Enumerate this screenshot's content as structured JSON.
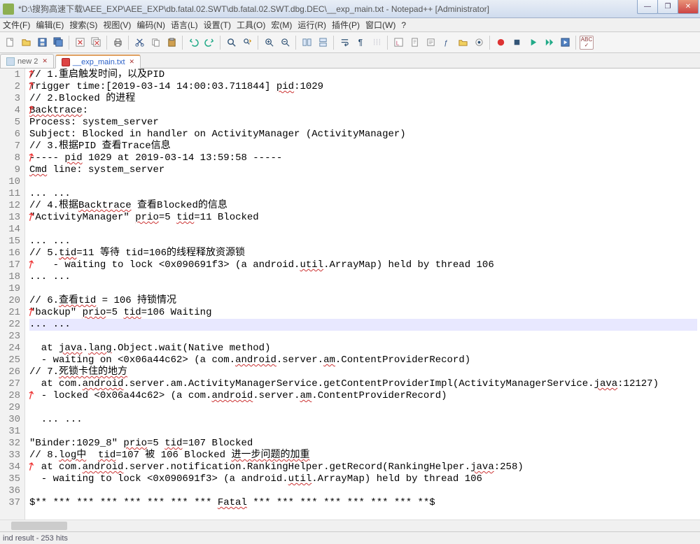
{
  "title": "*D:\\搜狗高速下载\\AEE_EXP\\AEE_EXP\\db.fatal.02.SWT\\db.fatal.02.SWT.dbg.DEC\\__exp_main.txt - Notepad++ [Administrator]",
  "win_controls": {
    "min": "—",
    "max": "❐",
    "close": "✕"
  },
  "menu": [
    "文件(F)",
    "编辑(E)",
    "搜索(S)",
    "视图(V)",
    "编码(N)",
    "语言(L)",
    "设置(T)",
    "工具(O)",
    "宏(M)",
    "运行(R)",
    "插件(P)",
    "窗口(W)",
    "?"
  ],
  "tabs": [
    {
      "label": "new 2",
      "active": false,
      "icon": "#6c8"
    },
    {
      "label": "__exp_main.txt",
      "active": true,
      "icon": "#d44"
    }
  ],
  "code_lines": [
    {
      "n": 1,
      "arrow": true,
      "text": "// 1.重启触发时间，以及PID"
    },
    {
      "n": 2,
      "arrow": true,
      "text": "Trigger time:[2019-03-14 14:00:03.711844] pid:1029",
      "wavy": [
        "pid"
      ]
    },
    {
      "n": 3,
      "arrow": false,
      "text": "// 2.Blocked 的进程"
    },
    {
      "n": 4,
      "arrow": true,
      "text": "Backtrace:",
      "wavy": [
        "Backtrace"
      ]
    },
    {
      "n": 5,
      "arrow": false,
      "text": "Process: system_server"
    },
    {
      "n": 6,
      "arrow": false,
      "text": "Subject: Blocked in handler on ActivityManager (ActivityManager)"
    },
    {
      "n": 7,
      "arrow": false,
      "text": "// 3.根据PID 查看Trace信息"
    },
    {
      "n": 8,
      "arrow": true,
      "text": "----- pid 1029 at 2019-03-14 13:59:58 -----",
      "wavy": [
        "pid"
      ]
    },
    {
      "n": 9,
      "arrow": false,
      "text": "Cmd line: system_server",
      "wavy": [
        "Cmd"
      ]
    },
    {
      "n": 10,
      "arrow": false,
      "text": ""
    },
    {
      "n": 11,
      "arrow": false,
      "text": "... ..."
    },
    {
      "n": 12,
      "arrow": false,
      "text": "// 4.根据Backtrace 查看Blocked的信息",
      "wavy": [
        "Backtrace"
      ]
    },
    {
      "n": 13,
      "arrow": true,
      "text": "\"ActivityManager\" prio=5 tid=11 Blocked",
      "wavy": [
        "prio",
        "tid"
      ]
    },
    {
      "n": 14,
      "arrow": false,
      "text": ""
    },
    {
      "n": 15,
      "arrow": false,
      "text": "... ..."
    },
    {
      "n": 16,
      "arrow": false,
      "text": "// 5.tid=11 等待 tid=106的线程释放资源锁",
      "wavy": [
        "tid",
        "tid"
      ]
    },
    {
      "n": 17,
      "arrow": true,
      "text": "    - waiting to lock <0x090691f3> (a android.util.ArrayMap) held by thread 106",
      "wavy": [
        "util"
      ]
    },
    {
      "n": 18,
      "arrow": false,
      "text": "... ..."
    },
    {
      "n": 19,
      "arrow": false,
      "text": ""
    },
    {
      "n": 20,
      "arrow": false,
      "text": "// 6.查看tid = 106 持锁情况",
      "wavy": [
        "查看tid"
      ]
    },
    {
      "n": 21,
      "arrow": true,
      "text": "\"backup\" prio=5 tid=106 Waiting",
      "wavy": [
        "prio",
        "tid"
      ]
    },
    {
      "n": 22,
      "arrow": false,
      "text": "... ...",
      "current": true
    },
    {
      "n": 23,
      "arrow": false,
      "text": ""
    },
    {
      "n": 24,
      "arrow": false,
      "text": "  at java.lang.Object.wait(Native method)",
      "wavy": [
        "java",
        "lang"
      ]
    },
    {
      "n": 25,
      "arrow": false,
      "text": "  - waiting on <0x06a44c62> (a com.android.server.am.ContentProviderRecord)",
      "wavy": [
        "android",
        "am"
      ]
    },
    {
      "n": 26,
      "arrow": false,
      "text": "// 7.死锁卡住的地方",
      "wavy": [
        "死锁卡住的地方"
      ]
    },
    {
      "n": 27,
      "arrow": false,
      "text": "  at com.android.server.am.ActivityManagerService.getContentProviderImpl(ActivityManagerService.java:12127)",
      "wavy": [
        "android",
        "java"
      ]
    },
    {
      "n": 28,
      "arrow": true,
      "text": "  - locked <0x06a44c62> (a com.android.server.am.ContentProviderRecord)",
      "wavy": [
        "android",
        "am"
      ]
    },
    {
      "n": 29,
      "arrow": false,
      "text": ""
    },
    {
      "n": 30,
      "arrow": false,
      "text": "  ... ..."
    },
    {
      "n": 31,
      "arrow": false,
      "text": ""
    },
    {
      "n": 32,
      "arrow": false,
      "text": "\"Binder:1029_8\" prio=5 tid=107 Blocked",
      "wavy": [
        "prio",
        "tid"
      ]
    },
    {
      "n": 33,
      "arrow": false,
      "text": "// 8.log中  tid=107 被 106 Blocked 进一步问题的加重",
      "wavy": [
        "log中",
        "tid",
        "进一步问题的加重"
      ]
    },
    {
      "n": 34,
      "arrow": true,
      "text": "  at com.android.server.notification.RankingHelper.getRecord(RankingHelper.java:258)",
      "wavy": [
        "android",
        "java"
      ]
    },
    {
      "n": 35,
      "arrow": false,
      "text": "  - waiting to lock <0x090691f3> (a android.util.ArrayMap) held by thread 106",
      "wavy": [
        "util"
      ]
    },
    {
      "n": 36,
      "arrow": false,
      "text": ""
    },
    {
      "n": 37,
      "arrow": false,
      "text": "$** *** *** *** *** *** *** *** Fatal *** *** *** *** *** *** *** **$",
      "wavy": [
        "Fatal"
      ]
    }
  ],
  "status": "ind result - 253 hits"
}
